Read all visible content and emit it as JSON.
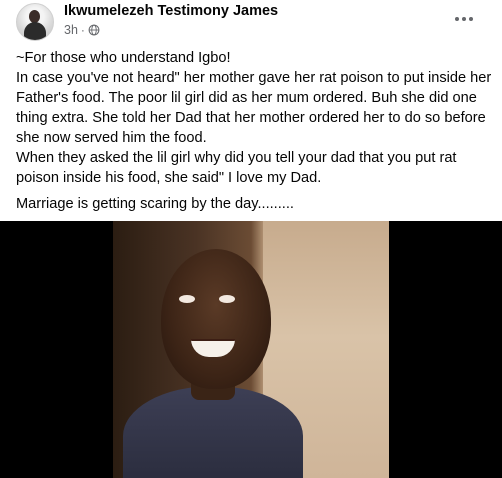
{
  "post": {
    "author_name": "Ikwumelezeh Testimony James",
    "timestamp": "3h",
    "separator": "·",
    "privacy_icon": "globe-icon",
    "more_icon": "more-horizontal-icon",
    "text_lines": [
      "~For those who understand Igbo!",
      "In case you've not heard\" her mother gave her rat poison to put inside her Father's food. The poor lil girl did as her mum ordered. Buh she did one thing extra. She told her Dad that her mother ordered her to do so before she now served him the food.",
      "When they asked the lil girl why did you tell your dad that you put rat poison inside his food, she said\" I love my Dad."
    ],
    "closing_line": "Marriage is getting scaring by the day.........",
    "media": {
      "type": "video-thumbnail"
    }
  },
  "colors": {
    "name": "#050505",
    "meta": "#65676b",
    "background": "#ffffff",
    "video_bg": "#000000"
  }
}
